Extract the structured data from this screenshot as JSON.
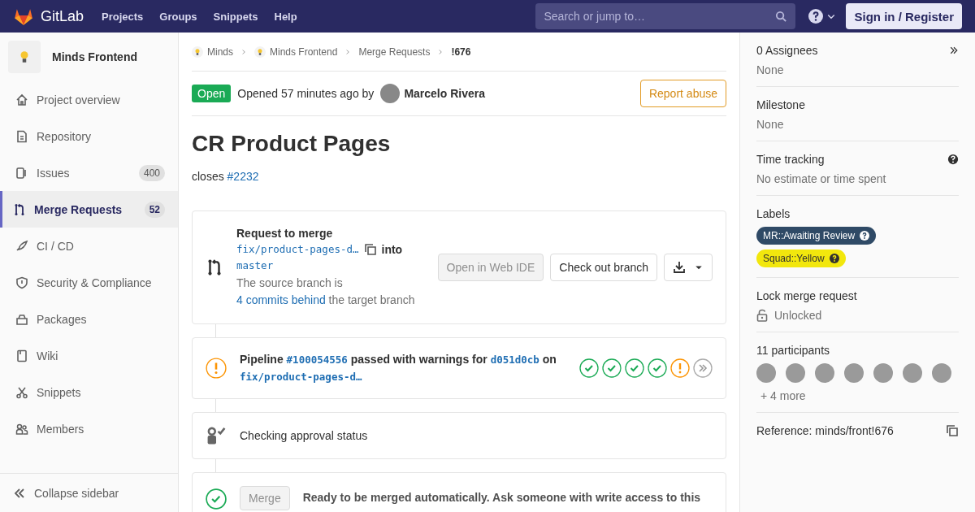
{
  "header": {
    "logo_text": "GitLab",
    "nav": [
      "Projects",
      "Groups",
      "Snippets",
      "Help"
    ],
    "search": {
      "placeholder": "Search or jump to…"
    },
    "sign_in": "Sign in / Register"
  },
  "sidebar": {
    "project": "Minds Frontend",
    "items": [
      {
        "label": "Project overview",
        "selected": false
      },
      {
        "label": "Repository",
        "selected": false
      },
      {
        "label": "Issues",
        "count": "400",
        "selected": false
      },
      {
        "label": "Merge Requests",
        "count": "52",
        "selected": true
      },
      {
        "label": "CI / CD",
        "selected": false
      },
      {
        "label": "Security & Compliance",
        "selected": false
      },
      {
        "label": "Packages",
        "selected": false
      },
      {
        "label": "Wiki",
        "selected": false
      },
      {
        "label": "Snippets",
        "selected": false
      },
      {
        "label": "Members",
        "selected": false
      }
    ],
    "collapse": "Collapse sidebar"
  },
  "breadcrumbs": [
    {
      "label": "Minds",
      "kind": "project",
      "current": false
    },
    {
      "label": "Minds Frontend",
      "kind": "project",
      "current": false
    },
    {
      "label": "Merge Requests",
      "kind": "page",
      "current": false
    },
    {
      "label": "!676",
      "kind": "page",
      "current": true
    }
  ],
  "mr": {
    "status": "Open",
    "opened": "Opened 57 minutes ago by",
    "author": "Marcelo Rivera",
    "report": "Report abuse",
    "title": "CR Product Pages",
    "description": {
      "before": "closes ",
      "link": "#2232"
    }
  },
  "widget": {
    "merge_request": {
      "heading": "Request to merge",
      "source": "fix/product-pages-d…",
      "into": "into",
      "target": "master",
      "behind": {
        "before": "The source branch is ",
        "link": "4 commits behind",
        "after": " the target branch"
      },
      "web_ide": {
        "label": "Open in Web IDE",
        "disabled": true
      },
      "checkout": "Check out branch"
    },
    "pipeline": {
      "label": "Pipeline",
      "id": "#100054556",
      "status_text": "passed with warnings for",
      "commit": "d051d0cb",
      "on": "on",
      "branch": "fix/product-pages-d…",
      "stages": [
        {
          "kind": "success"
        },
        {
          "kind": "success"
        },
        {
          "kind": "success"
        },
        {
          "kind": "success"
        },
        {
          "kind": "warning"
        },
        {
          "kind": "more"
        }
      ]
    },
    "approval": "Checking approval status",
    "merge": {
      "button": "Merge",
      "disabled": true,
      "message": "Ready to be merged automatically. Ask someone with write access to this"
    }
  },
  "right_sidebar": {
    "assignees": {
      "title": "0 Assignees",
      "value": "None"
    },
    "milestone": {
      "title": "Milestone",
      "value": "None"
    },
    "time_tracking": {
      "title": "Time tracking",
      "value": "No estimate or time spent"
    },
    "labels": {
      "title": "Labels",
      "items": [
        {
          "text": "MR::Awaiting Review",
          "color": "#2f4a66"
        },
        {
          "text": "Squad::Yellow",
          "color": "#f2e70d"
        }
      ]
    },
    "lock": {
      "title": "Lock merge request",
      "value": "Unlocked",
      "locked": false
    },
    "participants": {
      "title": "11 participants",
      "avatars": [
        {
          "kind": "photo"
        },
        {
          "kind": "photo"
        },
        {
          "kind": "photo"
        },
        {
          "kind": "photo"
        },
        {
          "kind": "photo"
        },
        {
          "kind": "photo"
        },
        {
          "kind": "photo"
        }
      ],
      "more": "+ 4 more"
    },
    "reference": "Reference: minds/front!676"
  }
}
